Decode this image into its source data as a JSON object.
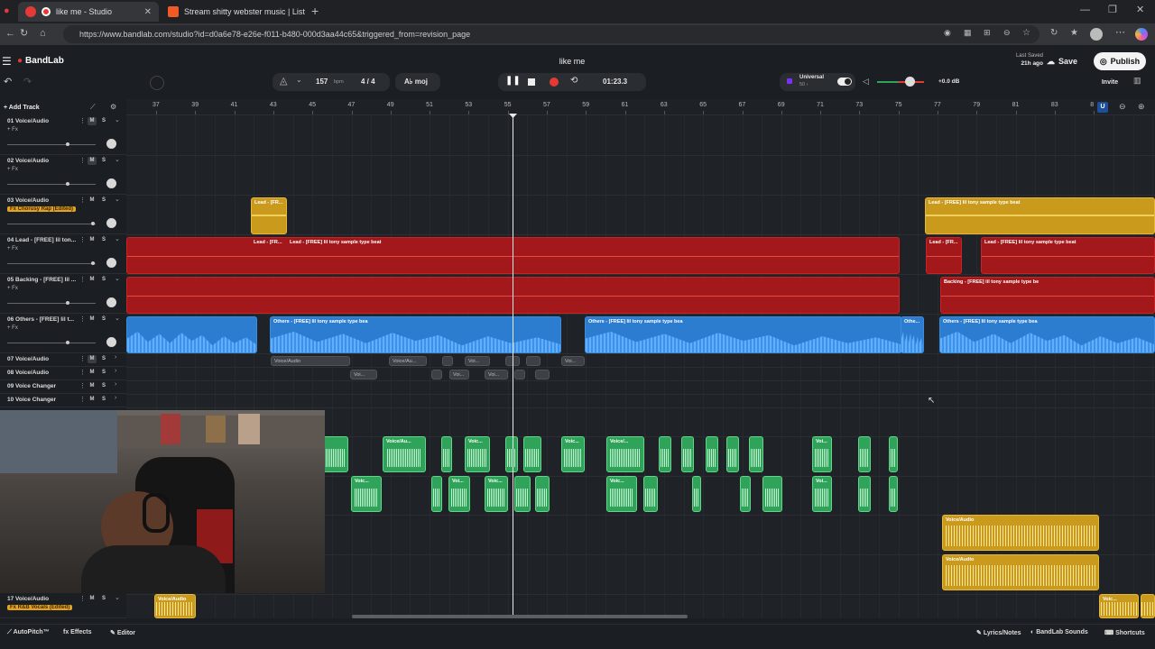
{
  "browser": {
    "tabs": [
      {
        "title": "like me - Studio",
        "active": true
      },
      {
        "title": "Stream shitty webster music | List",
        "active": false
      }
    ],
    "new_tab": "+",
    "url": "https://www.bandlab.com/studio?id=d0a6e78-e26e-f011-b480-000d3aa44c65&triggered_from=revision_page",
    "window_controls": [
      "—",
      "❐",
      "✕"
    ]
  },
  "app": {
    "logo": "BandLab",
    "project_title": "like me",
    "last_saved_label": "Last Saved",
    "last_saved_value": "21h ago",
    "save_label": "Save",
    "publish_label": "Publish",
    "invite_label": "Invite",
    "bpm_value": "157",
    "bpm_unit": "bpm",
    "time_signature": "4 / 4",
    "key_label": "moj",
    "time_display": "01:23.3",
    "universal_label": "Universal",
    "universal_sub": "50 ›",
    "master_db": "+0.0 dB",
    "add_track_label": "Add Track",
    "colors": {
      "accent_red": "#e53935",
      "clip_yellow": "#c99a1c",
      "clip_red": "#a3191b",
      "clip_blue": "#2c7cd0",
      "clip_green": "#2fa35a"
    }
  },
  "timeline": {
    "bars": [
      "37",
      "39",
      "41",
      "43",
      "45",
      "47",
      "49",
      "51",
      "53",
      "55",
      "57",
      "59",
      "61",
      "63",
      "65",
      "67",
      "69",
      "71",
      "73",
      "75",
      "77",
      "79",
      "81",
      "83",
      "8"
    ]
  },
  "tracks": [
    {
      "name": "01 Voice/Audio",
      "fx": "+ Fx",
      "fx_badge": false
    },
    {
      "name": "02 Voice/Audio",
      "fx": "+ Fx",
      "fx_badge": false
    },
    {
      "name": "03 Voice/Audio",
      "fx": "Fx Chorusy Rap (Edited)",
      "fx_badge": true
    },
    {
      "name": "04 Lead - [FREE] lil ton...",
      "fx": "+ Fx",
      "fx_badge": false
    },
    {
      "name": "05 Backing - [FREE] lil ...",
      "fx": "+ Fx",
      "fx_badge": false
    },
    {
      "name": "06 Others - [FREE] lil t...",
      "fx": "+ Fx",
      "fx_badge": false
    },
    {
      "name": "07 Voice/Audio"
    },
    {
      "name": "08 Voice/Audio"
    },
    {
      "name": "09 Voice Changer"
    },
    {
      "name": "10 Voice Changer"
    },
    {
      "name": "17 Voice/Audio",
      "fx": "Fx R&B Vocals (Edited)",
      "fx_badge": true
    }
  ],
  "track_buttons": {
    "mute": "M",
    "solo": "S"
  },
  "clips": {
    "lead_short": "Lead - [FR...",
    "lead_full": "Lead - [FREE] lil tony sample type beat",
    "backing": "Backing - [FREE] lil tony sample type be",
    "others": "Others - [FREE] lil tony sample type bea",
    "others_short": "Othe...",
    "voice_audio": "Voice/Audio",
    "voice_short": "Voic...",
    "voice_mid": "Voice/Au...",
    "voice_tiny": "Voi...",
    "voice_r": "Voice/..."
  },
  "bottom_bar": {
    "autopitch": "AutoPitch™",
    "effects": "Effects",
    "editor": "Editor",
    "lyrics": "Lyrics/Notes",
    "sounds": "BandLab Sounds",
    "shortcuts": "Shortcuts"
  }
}
